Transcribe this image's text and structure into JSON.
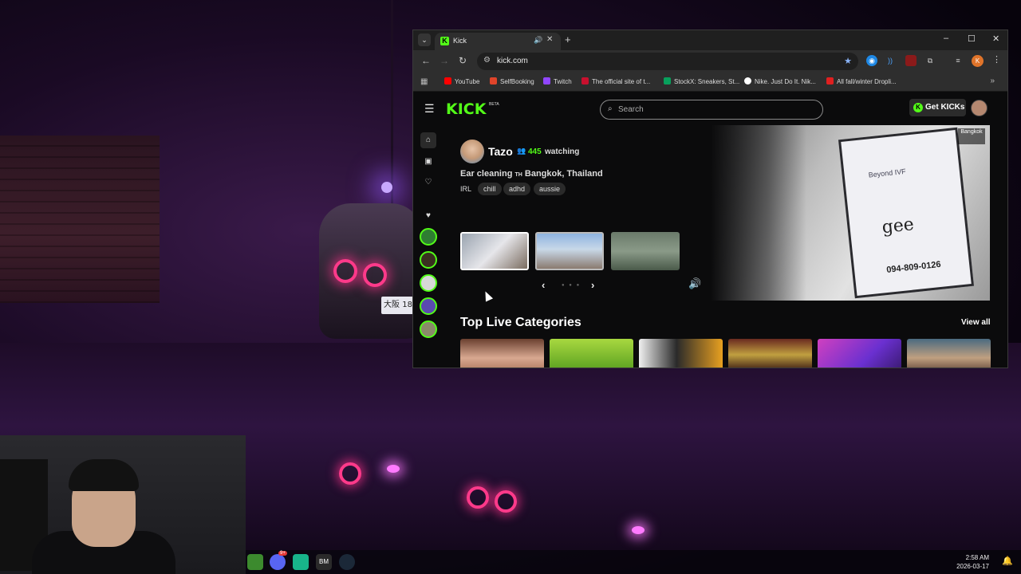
{
  "browser": {
    "tab_title": "Kick",
    "url": "kick.com",
    "window_controls": {
      "minimize": "–",
      "maximize": "☐",
      "close": "✕"
    }
  },
  "bookmarks": [
    {
      "label": "YouTube",
      "color": "#ff0000"
    },
    {
      "label": "SelfBooking",
      "color": "#e0442a"
    },
    {
      "label": "Twitch",
      "color": "#9146ff"
    },
    {
      "label": "The official site of t...",
      "color": "#c8102e"
    },
    {
      "label": "StockX: Sneakers, St...",
      "color": "#08a05c"
    },
    {
      "label": "Nike. Just Do It. Nik...",
      "color": "#ffffff"
    },
    {
      "label": "All fall/winter Dropli...",
      "color": "#e02020"
    }
  ],
  "kick": {
    "logo": "KICK",
    "beta": "BETA",
    "search_placeholder": "Search",
    "get_kicks": "Get KICKs",
    "accent": "#53fc18"
  },
  "featured": {
    "streamer": "Tazo",
    "viewers": "445",
    "viewers_label": "watching",
    "title": "Ear cleaning",
    "flag": "TH",
    "location": "Bangkok, Thailand",
    "category": "IRL",
    "tags": [
      "chill",
      "adhd",
      "aussie"
    ],
    "video_overlay": {
      "city": "Bangkok",
      "brand": "gee",
      "phone": "094-809-0126",
      "sign_top": "Beyond IVF"
    }
  },
  "sections": {
    "top_live_categories": "Top Live Categories",
    "view_all": "View all"
  },
  "taskbar": {
    "time": "2:58 AM",
    "date": "2026-03-17",
    "discord_badge": "9+"
  }
}
